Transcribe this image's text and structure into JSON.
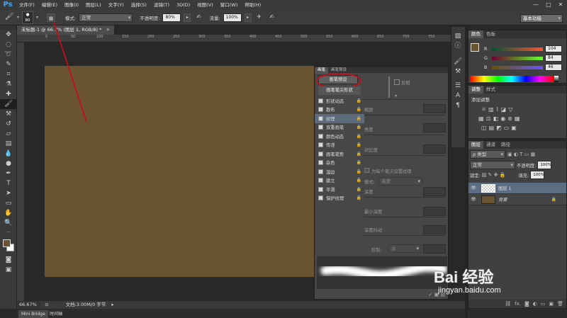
{
  "app": {
    "logo": "Ps"
  },
  "menu": [
    "文件(F)",
    "编辑(E)",
    "图像(I)",
    "图层(L)",
    "文字(Y)",
    "选择(S)",
    "滤镜(T)",
    "3D(D)",
    "视图(V)",
    "窗口(W)",
    "帮助(H)"
  ],
  "window_controls": [
    "—",
    "□",
    "✕"
  ],
  "options": {
    "brush_size": "80",
    "mode_label": "模式:",
    "mode_value": "正常",
    "opacity_label": "不透明度:",
    "opacity_value": "80%",
    "flow_label": "流量:",
    "flow_value": "100%",
    "workspace": "基本功能"
  },
  "document": {
    "tab_title": "未标题-1 @ 66.7% (图层 1, RGB/8) *",
    "tab_close": "✕",
    "canvas_color": "#6a5331",
    "ruler_ticks": [
      "0",
      "50",
      "100",
      "150",
      "200",
      "250",
      "300",
      "350",
      "400",
      "450",
      "500",
      "550",
      "600",
      "650",
      "700",
      "750",
      "800"
    ],
    "zoom": "66.67%",
    "doc_info": "文档:3.00M/0 字节"
  },
  "bottom_tabs": [
    "Mini Bridge",
    "时间轴"
  ],
  "color_panel": {
    "tabs": [
      "颜色",
      "色板"
    ],
    "swatch": "#6a5431",
    "channels": [
      {
        "label": "R",
        "value": "104"
      },
      {
        "label": "G",
        "value": "84"
      },
      {
        "label": "B",
        "value": "46"
      }
    ]
  },
  "adjust_panel": {
    "tabs": [
      "调整",
      "样式"
    ],
    "title": "添加调整"
  },
  "layers_panel": {
    "tabs": [
      "图层",
      "通道",
      "路径"
    ],
    "kind": "ρ 类型",
    "blend_mode": "正常",
    "opacity_label": "不透明度:",
    "opacity_value": "100%",
    "lock_label": "锁定:",
    "fill_label": "填充:",
    "fill_value": "100%",
    "layers": [
      {
        "name": "图层 1",
        "selected": true
      },
      {
        "name": "背景",
        "selected": false
      }
    ],
    "footer_icons": [
      "⛓",
      "fx.",
      "◙",
      "◐",
      "▭",
      "▣",
      "🗑"
    ]
  },
  "brush_panel": {
    "tabs": [
      "画笔",
      "画笔预设"
    ],
    "preset_button": "画笔预设",
    "tip_shape": "画笔笔尖形状",
    "invert_label": "反相",
    "options": [
      {
        "label": "形状动态",
        "checked": false,
        "selected": false
      },
      {
        "label": "散布",
        "checked": false,
        "selected": false
      },
      {
        "label": "纹理",
        "checked": false,
        "selected": true
      },
      {
        "label": "双重画笔",
        "checked": false,
        "selected": false
      },
      {
        "label": "颜色动态",
        "checked": false,
        "selected": false
      },
      {
        "label": "传递",
        "checked": false,
        "selected": false
      },
      {
        "label": "画笔笔势",
        "checked": false,
        "selected": false
      },
      {
        "label": "杂色",
        "checked": false,
        "selected": false
      },
      {
        "label": "湿边",
        "checked": false,
        "selected": false
      },
      {
        "label": "建立",
        "checked": false,
        "selected": false
      },
      {
        "label": "平滑",
        "checked": false,
        "selected": false
      },
      {
        "label": "保护纹理",
        "checked": false,
        "selected": false
      }
    ],
    "settings": {
      "scale": "缩放",
      "brightness": "亮度",
      "contrast": "对比度",
      "per_tip": "为每个笔尖设置纹理",
      "mode_label": "模式:",
      "mode_value": "高度",
      "depth": "深度",
      "min_depth": "最小深度",
      "depth_jitter": "深度抖动",
      "control_label": "控制:",
      "control_value": "关"
    }
  },
  "watermark": {
    "text": "Bai 经验",
    "url": "jingyan.baidu.com"
  },
  "annotation_color": "#c0111a"
}
